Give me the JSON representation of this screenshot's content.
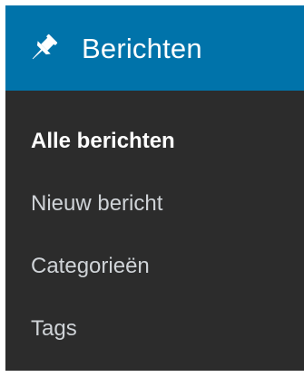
{
  "menu": {
    "title": "Berichten",
    "icon": "pushpin-icon",
    "colors": {
      "header_bg": "#0073aa",
      "panel_bg": "#2c2c2c",
      "active_text": "#ffffff",
      "item_text": "#cfd3d7"
    },
    "items": [
      {
        "label": "Alle berichten",
        "current": true
      },
      {
        "label": "Nieuw bericht",
        "current": false
      },
      {
        "label": "Categorieën",
        "current": false
      },
      {
        "label": "Tags",
        "current": false
      }
    ]
  }
}
